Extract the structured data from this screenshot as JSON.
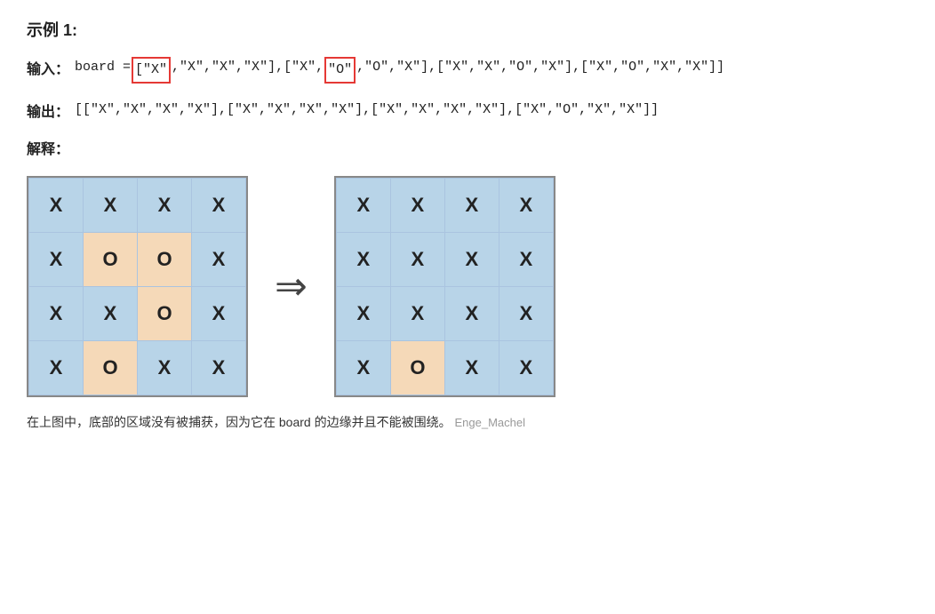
{
  "title": "示例 1:",
  "input": {
    "label": "输入：",
    "code_prefix": "board = ",
    "highlighted1": "[\"X\"",
    "middle1": ",\"X\",\"X\",\"X\"],[\"X\",",
    "highlighted2": "\"O\"",
    "code_suffix": ",\"O\",\"X\"],[\"X\",\"X\",\"O\",\"X\"],[\"X\",\"O\",\"X\",\"X\"]]"
  },
  "output": {
    "label": "输出：",
    "code": "[[\"X\",\"X\",\"X\",\"X\"],[\"X\",\"X\",\"X\",\"X\"],[\"X\",\"X\",\"X\",\"X\"],[\"X\",\"O\",\"X\",\"X\"]]"
  },
  "explain_label": "解释：",
  "board_before": [
    [
      "X",
      "X",
      "X",
      "X"
    ],
    [
      "X",
      "O",
      "O",
      "X"
    ],
    [
      "X",
      "X",
      "O",
      "X"
    ],
    [
      "X",
      "O",
      "X",
      "X"
    ]
  ],
  "board_after": [
    [
      "X",
      "X",
      "X",
      "X"
    ],
    [
      "X",
      "X",
      "X",
      "X"
    ],
    [
      "X",
      "X",
      "X",
      "X"
    ],
    [
      "X",
      "O",
      "X",
      "X"
    ]
  ],
  "orange_cells_before": [
    [
      1,
      1
    ],
    [
      1,
      2
    ],
    [
      2,
      2
    ],
    [
      3,
      1
    ]
  ],
  "orange_cells_after": [
    [
      3,
      1
    ]
  ],
  "footer": "在上图中，底部的区域没有被捕获，因为它在 board 的边缘并且不能被围绕。",
  "watermark": "Enge_Machel"
}
